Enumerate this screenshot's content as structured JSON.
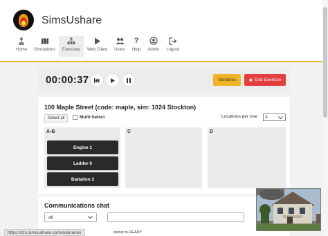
{
  "app": {
    "title": "SimsUshare",
    "accent_color": "#f1b13a"
  },
  "nav": {
    "items": [
      {
        "label": "Home",
        "icon": "person-walk-icon"
      },
      {
        "label": "Simulations",
        "icon": "map-icon"
      },
      {
        "label": "Exercises",
        "icon": "org-chart-icon",
        "active": true
      },
      {
        "label": "Web Client",
        "icon": "play-icon"
      },
      {
        "label": "Users",
        "icon": "users-icon"
      },
      {
        "label": "Help",
        "icon": "question-icon"
      },
      {
        "label": "Admin",
        "icon": "user-circle-icon"
      },
      {
        "label": "Logout",
        "icon": "logout-icon"
      }
    ]
  },
  "timer": {
    "value": "00:00:37",
    "variables_label": "Variables",
    "end_label": "End Exercise",
    "variables_color": "#f0b429",
    "end_color": "#e53e3e"
  },
  "exercise": {
    "title": "100 Maple Street (code: maple, sim: 1024 Stockton)",
    "select_all_label": "Select all",
    "multi_select_label": "Multi-Select",
    "locations_label": "Locations per row:",
    "locations_value": "3",
    "columns": [
      {
        "label": "A-B",
        "units": [
          "Engine 1",
          "Ladder 6",
          "Battalion 3"
        ]
      },
      {
        "label": "C",
        "units": []
      },
      {
        "label": "D",
        "units": []
      }
    ]
  },
  "chat": {
    "title": "Communications chat",
    "filter_value": "all",
    "input_placeholder": ""
  },
  "status": {
    "url": "https://ctc.simsushare.com/scenarios",
    "text": "status to READY"
  }
}
